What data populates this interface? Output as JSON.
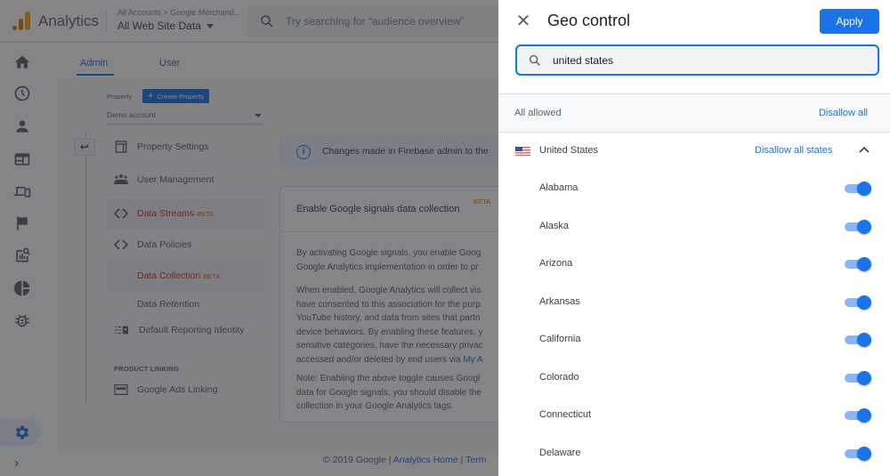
{
  "topbar": {
    "app_name": "Analytics",
    "breadcrumb": "All Accounts > Google Merchand...",
    "view_selector": "All Web Site Data",
    "search_placeholder": "Try searching for “audience overview”"
  },
  "rail": {
    "icons": [
      "home-icon",
      "clock-icon",
      "person-icon",
      "dashboard-icon",
      "devices-icon",
      "flag-icon",
      "report-search-icon",
      "pie-chart-icon",
      "bug-icon"
    ],
    "settings_icon": "gear-icon",
    "expand_icon": "chevron-right-icon"
  },
  "admin": {
    "tabs": [
      {
        "label": "Admin",
        "active": true
      },
      {
        "label": "User",
        "active": false
      }
    ],
    "property_label": "Property",
    "create_property_label": "Create Property",
    "account_selector": "Demo account",
    "back_icon": "↩",
    "nav": [
      {
        "label": "Property Settings",
        "icon": "layout-icon",
        "selected": false,
        "red": false,
        "beta": ""
      },
      {
        "label": "User Management",
        "icon": "people-icon",
        "selected": false,
        "red": false,
        "beta": ""
      },
      {
        "label": "Data Streams",
        "icon": "code-icon",
        "selected": true,
        "red": true,
        "beta": "BETA"
      },
      {
        "label": "Data Policies",
        "icon": "code-icon",
        "selected": false,
        "red": false,
        "beta": ""
      },
      {
        "label": "Data Collection",
        "icon": "",
        "selected": true,
        "red": true,
        "beta": "BETA"
      },
      {
        "label": "Data Retention",
        "icon": "",
        "selected": false,
        "red": false,
        "beta": ""
      },
      {
        "label": "Default Reporting Identity",
        "icon": "identity-icon",
        "selected": false,
        "red": false,
        "beta": ""
      }
    ],
    "product_linking_header": "PRODUCT LINKING",
    "product_linking": [
      {
        "label": "Google Ads Linking",
        "icon": "ads-icon"
      }
    ],
    "banner_text": "Changes made in Firebase admin to the",
    "card": {
      "title": "Enable Google signals data collection",
      "beta": "BETA",
      "p1": [
        "By activating Google signals, you enable Goog",
        "Google Analytics implementation in order to pr"
      ],
      "p2": [
        "When enabled, Google Analytics will collect vis",
        "have consented to this association for the purp",
        "YouTube history, and data from sites that partn",
        "device behaviors. By enabling these features, y",
        "sensitive categories, have the necessary privac",
        "accessed and/or deleted by end users via "
      ],
      "p2_link": "My A",
      "p3": [
        "Note: Enabling the above toggle causes Googl",
        "data for Google signals, you should disable the",
        "collection in your Google Analytics tags."
      ]
    },
    "footer": {
      "copyright": "© 2019 Google | ",
      "home_link": "Analytics Home",
      "sep": " | ",
      "terms_link": "Term"
    }
  },
  "geo_panel": {
    "title": "Geo control",
    "apply_label": "Apply",
    "search_value": "united states",
    "all_allowed_label": "All allowed",
    "disallow_all_label": "Disallow all",
    "country": {
      "name": "United States",
      "disallow_states_label": "Disallow all states",
      "expanded": true
    },
    "states": [
      {
        "name": "Alabama",
        "allowed": true
      },
      {
        "name": "Alaska",
        "allowed": true
      },
      {
        "name": "Arizona",
        "allowed": true
      },
      {
        "name": "Arkansas",
        "allowed": true
      },
      {
        "name": "California",
        "allowed": true
      },
      {
        "name": "Colorado",
        "allowed": true
      },
      {
        "name": "Connecticut",
        "allowed": true
      },
      {
        "name": "Delaware",
        "allowed": true
      }
    ]
  }
}
